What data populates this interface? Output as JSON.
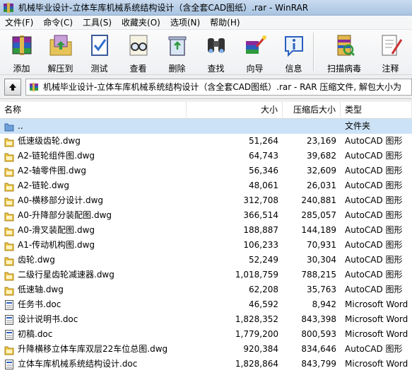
{
  "window": {
    "title": "机械毕业设计-立体车库机械系统结构设计（含全套CAD图纸）.rar - WinRAR"
  },
  "menu": [
    "文件(F)",
    "命令(C)",
    "工具(S)",
    "收藏夹(O)",
    "选项(N)",
    "帮助(H)"
  ],
  "toolbar": {
    "add": "添加",
    "extract": "解压到",
    "test": "测试",
    "view": "查看",
    "delete": "删除",
    "find": "查找",
    "wizard": "向导",
    "info": "信息",
    "scan": "扫描病毒",
    "comment": "注释"
  },
  "path": {
    "text": "机械毕业设计-立体车库机械系统结构设计（含全套CAD图纸）.rar - RAR 压缩文件, 解包大小为"
  },
  "columns": {
    "name": "名称",
    "size": "大小",
    "packed": "压缩后大小",
    "type": "类型"
  },
  "rows": [
    {
      "name": "..",
      "size": "",
      "packed": "",
      "type": "文件夹",
      "icon": "folder-up-icon"
    },
    {
      "name": "低速级齿轮.dwg",
      "size": "51,264",
      "packed": "23,169",
      "type": "AutoCAD 图形",
      "icon": "dwg-file-icon"
    },
    {
      "name": "A2-链轮组件图.dwg",
      "size": "64,743",
      "packed": "39,682",
      "type": "AutoCAD 图形",
      "icon": "dwg-file-icon"
    },
    {
      "name": "A2-轴零件图.dwg",
      "size": "56,346",
      "packed": "32,609",
      "type": "AutoCAD 图形",
      "icon": "dwg-file-icon"
    },
    {
      "name": "A2-链轮.dwg",
      "size": "48,061",
      "packed": "26,031",
      "type": "AutoCAD 图形",
      "icon": "dwg-file-icon"
    },
    {
      "name": "A0-横移部分设计.dwg",
      "size": "312,708",
      "packed": "240,881",
      "type": "AutoCAD 图形",
      "icon": "dwg-file-icon"
    },
    {
      "name": "A0-升降部分装配图.dwg",
      "size": "366,514",
      "packed": "285,057",
      "type": "AutoCAD 图形",
      "icon": "dwg-file-icon"
    },
    {
      "name": "A0-滑叉装配图.dwg",
      "size": "188,887",
      "packed": "144,189",
      "type": "AutoCAD 图形",
      "icon": "dwg-file-icon"
    },
    {
      "name": "A1-传动机构图.dwg",
      "size": "106,233",
      "packed": "70,931",
      "type": "AutoCAD 图形",
      "icon": "dwg-file-icon"
    },
    {
      "name": "齿轮.dwg",
      "size": "52,249",
      "packed": "30,304",
      "type": "AutoCAD 图形",
      "icon": "dwg-file-icon"
    },
    {
      "name": "二级行星齿轮减速器.dwg",
      "size": "1,018,759",
      "packed": "788,215",
      "type": "AutoCAD 图形",
      "icon": "dwg-file-icon"
    },
    {
      "name": "低速轴.dwg",
      "size": "62,208",
      "packed": "35,763",
      "type": "AutoCAD 图形",
      "icon": "dwg-file-icon"
    },
    {
      "name": "任务书.doc",
      "size": "46,592",
      "packed": "8,942",
      "type": "Microsoft Word",
      "icon": "doc-file-icon"
    },
    {
      "name": "设计说明书.doc",
      "size": "1,828,352",
      "packed": "843,398",
      "type": "Microsoft Word",
      "icon": "doc-file-icon"
    },
    {
      "name": "初稿.doc",
      "size": "1,779,200",
      "packed": "800,593",
      "type": "Microsoft Word",
      "icon": "doc-file-icon"
    },
    {
      "name": "升降横移立体车库双层22车位总图.dwg",
      "size": "920,384",
      "packed": "834,646",
      "type": "AutoCAD 图形",
      "icon": "dwg-file-icon"
    },
    {
      "name": "立体车库机械系统结构设计.doc",
      "size": "1,828,864",
      "packed": "843,799",
      "type": "Microsoft Word",
      "icon": "doc-file-icon"
    }
  ]
}
